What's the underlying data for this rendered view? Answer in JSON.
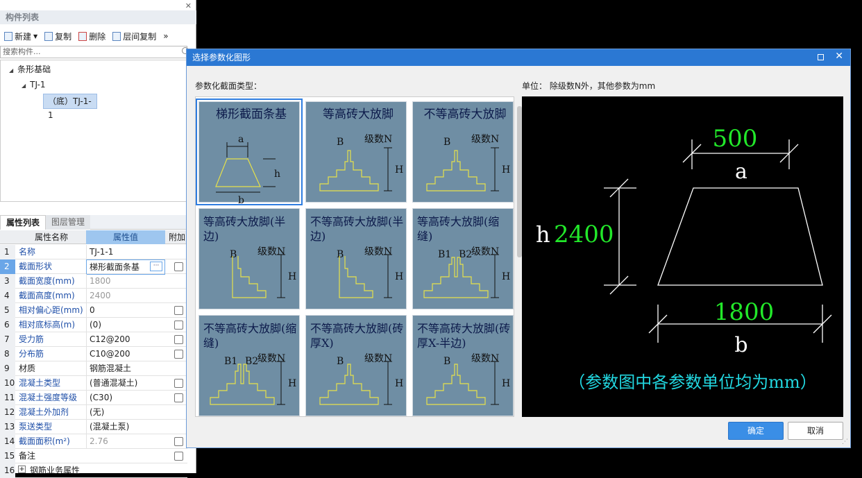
{
  "left_panel": {
    "component_list_title": "构件列表",
    "toolbar": {
      "new": "新建",
      "copy": "复制",
      "delete": "删除",
      "floor_copy": "层间复制",
      "more": "»"
    },
    "search_placeholder": "搜索构件...",
    "tree": {
      "root": "条形基础",
      "child": "TJ-1",
      "leaf": "（底）TJ-1-1"
    },
    "tabs": {
      "props": "属性列表",
      "layers": "图层管理"
    },
    "headers": {
      "name": "属性名称",
      "value": "属性值",
      "extra": "附加"
    },
    "rows": [
      {
        "n": "1",
        "name": "名称",
        "value": "TJ-1-1"
      },
      {
        "n": "2",
        "name": "截面形状",
        "value": "梯形截面条基"
      },
      {
        "n": "3",
        "name": "截面宽度(mm)",
        "value": "1800"
      },
      {
        "n": "4",
        "name": "截面高度(mm)",
        "value": "2400"
      },
      {
        "n": "5",
        "name": "相对偏心距(mm)",
        "value": "0"
      },
      {
        "n": "6",
        "name": "相对底标高(m)",
        "value": "(0)"
      },
      {
        "n": "7",
        "name": "受力筋",
        "value": "C12@200"
      },
      {
        "n": "8",
        "name": "分布筋",
        "value": "C10@200"
      },
      {
        "n": "9",
        "name": "材质",
        "value": "钢筋混凝土"
      },
      {
        "n": "10",
        "name": "混凝土类型",
        "value": "(普通混凝土)"
      },
      {
        "n": "11",
        "name": "混凝土强度等级",
        "value": "(C30)"
      },
      {
        "n": "12",
        "name": "混凝土外加剂",
        "value": "(无)"
      },
      {
        "n": "13",
        "name": "泵送类型",
        "value": "(混凝土泵)"
      },
      {
        "n": "14",
        "name": "截面面积(m²)",
        "value": "2.76"
      },
      {
        "n": "15",
        "name": "备注",
        "value": ""
      },
      {
        "n": "16",
        "name": "钢筋业务属性",
        "value": ""
      }
    ]
  },
  "dialog": {
    "title": "选择参数化图形",
    "type_label": "参数化截面类型：",
    "unit_label": "单位：  除级数N外，其他参数为mm",
    "ok": "确定",
    "cancel": "取消",
    "tiles": [
      {
        "title": "梯形截面条基",
        "a": "a",
        "h": "h",
        "b": "b"
      },
      {
        "title": "等高砖大放脚",
        "B": "B",
        "N": "级数N",
        "H": "H"
      },
      {
        "title": "不等高砖大放脚",
        "B": "B",
        "N": "级数N",
        "H": "H"
      },
      {
        "title": "等高砖大放脚(半边)",
        "B": "B",
        "N": "级数N",
        "H": "H"
      },
      {
        "title": "不等高砖大放脚(半边)",
        "B": "B",
        "N": "级数N",
        "H": "H"
      },
      {
        "title": "等高砖大放脚(缩缝)",
        "B1": "B1",
        "B2": "B2",
        "N": "级数N",
        "H": "H"
      },
      {
        "title": "不等高砖大放脚(缩缝)",
        "B1": "B1",
        "B2": "B2",
        "N": "级数N",
        "H": "H"
      },
      {
        "title": "不等高砖大放脚(砖厚X)",
        "B": "B",
        "N": "级数N",
        "H": "H"
      },
      {
        "title": "不等高砖大放脚(砖厚X-半边)",
        "B": "B",
        "N": "级数N",
        "H": "H"
      }
    ],
    "preview": {
      "a_val": "500",
      "a": "a",
      "h": "h",
      "h_val": "2400",
      "b_val": "1800",
      "b": "b",
      "note": "（参数图中各参数单位均为mm）"
    }
  }
}
